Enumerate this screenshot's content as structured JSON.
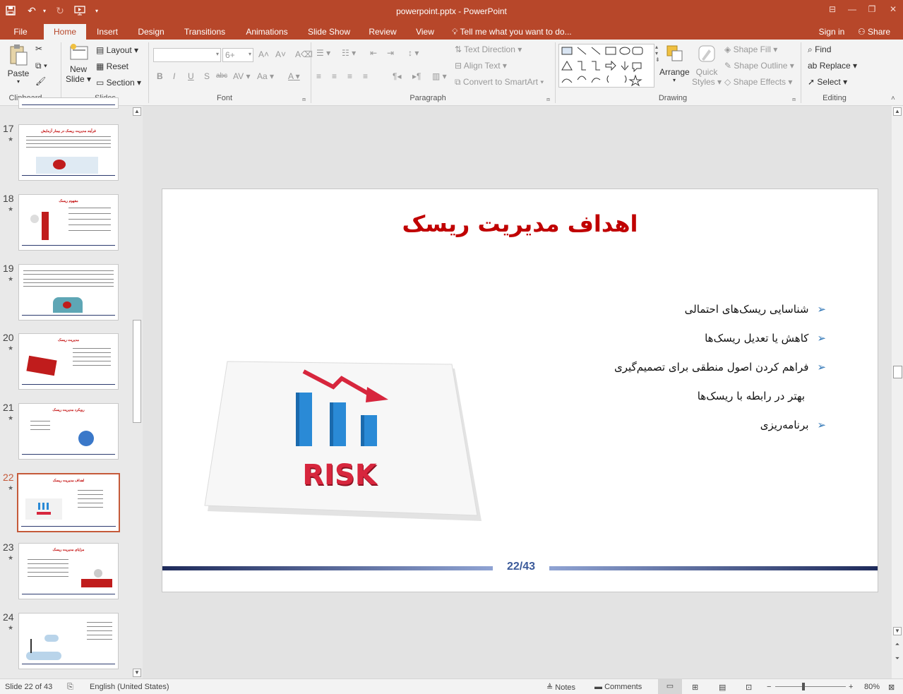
{
  "window": {
    "title": "powerpoint.pptx - PowerPoint",
    "minimize": "—",
    "restore": "❐",
    "close": "✕",
    "ribbon_options": "⊟"
  },
  "tabs": [
    "File",
    "Home",
    "Insert",
    "Design",
    "Transitions",
    "Animations",
    "Slide Show",
    "Review",
    "View"
  ],
  "active_tab": "Home",
  "tell_me": "Tell me what you want to do...",
  "sign_in": "Sign in",
  "share": "Share",
  "ribbon": {
    "clipboard": {
      "paste": "Paste",
      "label": "Clipboard"
    },
    "slides": {
      "new_slide_1": "New",
      "new_slide_2": "Slide",
      "layout": "Layout",
      "reset": "Reset",
      "section": "Section",
      "label": "Slides"
    },
    "font": {
      "font_name": "",
      "font_size": "6+",
      "label": "Font",
      "bold": "B",
      "italic": "I",
      "underline": "U",
      "shadow": "S",
      "strike": "abc",
      "spacing": "AV",
      "case": "Aa",
      "color": "A"
    },
    "paragraph": {
      "text_direction": "Text Direction",
      "align_text": "Align Text",
      "convert_smartart": "Convert to SmartArt",
      "label": "Paragraph"
    },
    "drawing": {
      "arrange": "Arrange",
      "quick_styles_1": "Quick",
      "quick_styles_2": "Styles",
      "shape_fill": "Shape Fill",
      "shape_outline": "Shape Outline",
      "shape_effects": "Shape Effects",
      "label": "Drawing"
    },
    "editing": {
      "find": "Find",
      "replace": "Replace",
      "select": "Select",
      "label": "Editing"
    }
  },
  "thumbnails": [
    {
      "num": "17",
      "title": "فرآیند مدیریت ریسک در بیمار آزمایش"
    },
    {
      "num": "18",
      "title": "مفهوم ریسک"
    },
    {
      "num": "19",
      "title": ""
    },
    {
      "num": "20",
      "title": "مدیریت ریسک"
    },
    {
      "num": "21",
      "title": "رویکرد مدیریت ریسک"
    },
    {
      "num": "22",
      "title": "اهداف مدیریت ریسک",
      "selected": true
    },
    {
      "num": "23",
      "title": "مزایای مدیریت ریسک"
    },
    {
      "num": "24",
      "title": ""
    }
  ],
  "slide": {
    "title": "اهداف مدیریت ریسک",
    "bullets": [
      "شناسایی ریسک‌های احتمالی",
      "کاهش یا تعدیل ریسک‌ها",
      "فراهم کردن اصول منطقی برای تصمیم‌گیری",
      "بهتر در رابطه با ریسک‌ها",
      "برنامه‌ریزی"
    ],
    "image_text": "RISK",
    "page_number": "22/43",
    "colors": {
      "title": "#c00000",
      "bar_dark": "#2b3a6e",
      "bar_light": "#8fa3d3",
      "bullet_arrow": "#2e75b6"
    }
  },
  "status": {
    "slide_of": "Slide 22 of 43",
    "language": "English (United States)",
    "notes": "Notes",
    "comments": "Comments",
    "zoom": "80%"
  }
}
